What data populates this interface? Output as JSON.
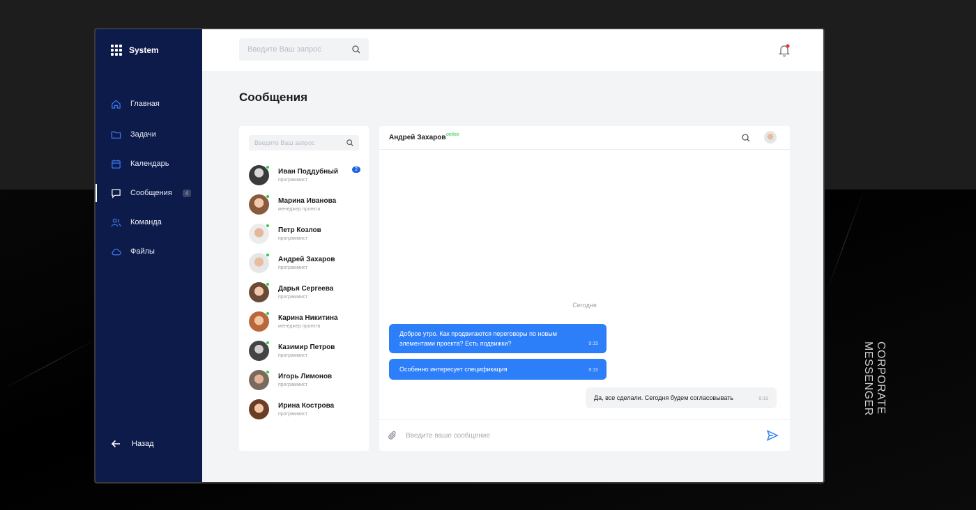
{
  "brand": {
    "name": "System"
  },
  "sidebar": {
    "items": [
      {
        "label": "Главная",
        "icon": "home-icon"
      },
      {
        "label": "Задачи",
        "icon": "folder-icon"
      },
      {
        "label": "Календарь",
        "icon": "calendar-icon"
      },
      {
        "label": "Сообщения",
        "icon": "message-icon",
        "badge": "4",
        "active": true
      },
      {
        "label": "Команда",
        "icon": "team-icon"
      },
      {
        "label": "Файлы",
        "icon": "cloud-icon"
      }
    ],
    "back_label": "Назад"
  },
  "topbar": {
    "search_placeholder": "Введите Ваш запрос",
    "notification_dot_color": "#e53935"
  },
  "page": {
    "title": "Сообщения"
  },
  "contacts": {
    "search_placeholder": "Введите Ваш запрос",
    "items": [
      {
        "name": "Иван Поддубный",
        "role": "программист",
        "unread": "2"
      },
      {
        "name": "Марина Иванова",
        "role": "менеджер проекта"
      },
      {
        "name": "Петр Козлов",
        "role": "программист"
      },
      {
        "name": "Андрей Захаров",
        "role": "программист"
      },
      {
        "name": "Дарья Сергеева",
        "role": "программист"
      },
      {
        "name": "Карина Никитина",
        "role": "менеджер проекта"
      },
      {
        "name": "Казимир Петров",
        "role": "программист"
      },
      {
        "name": "Игорь Лимонов",
        "role": "программист"
      },
      {
        "name": "Ирина Кострова",
        "role": "программист"
      }
    ]
  },
  "chat": {
    "contact_name": "Андрей Захаров",
    "status": "online",
    "day_separator": "Сегодня",
    "messages": [
      {
        "text": "Доброе утро. Как продвигаются переговоры по новым элементами проекта? Есть подвижки?",
        "time": "9:15",
        "direction": "out"
      },
      {
        "text": "Особенно интересует спецификация",
        "time": "9:15",
        "direction": "out"
      },
      {
        "text": "Да, все сделали. Сегодня будем согласовывать",
        "time": "9:19",
        "direction": "in"
      }
    ],
    "composer_placeholder": "Введите ваше сообщение"
  },
  "side_caption": "CORPORATE MESSENGER",
  "colors": {
    "sidebar_bg": "#0d1b4a",
    "accent": "#2d7ff9",
    "online": "#2ecc40"
  }
}
